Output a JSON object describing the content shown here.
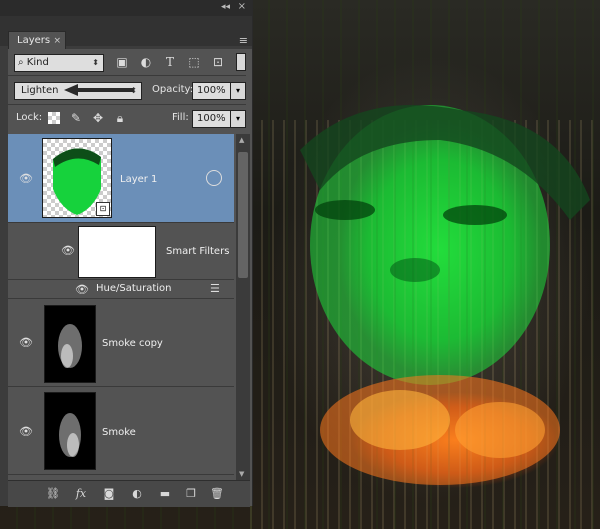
{
  "panel": {
    "tab_label": "Layers",
    "filter": {
      "label": "Kind"
    },
    "blend_mode": "Lighten",
    "opacity_label": "Opacity:",
    "opacity_value": "100%",
    "lock_label": "Lock:",
    "fill_label": "Fill:",
    "fill_value": "100%"
  },
  "layers": [
    {
      "name": "Layer 1",
      "selected": true,
      "visible": true
    },
    {
      "name": "Smart Filters",
      "visible": true
    },
    {
      "name": "Hue/Saturation",
      "visible": true
    },
    {
      "name": "Smoke copy",
      "visible": true
    },
    {
      "name": "Smoke",
      "visible": true
    }
  ],
  "colors": {
    "accent_selected": "#6b8fb8",
    "panel_bg": "#535353"
  }
}
